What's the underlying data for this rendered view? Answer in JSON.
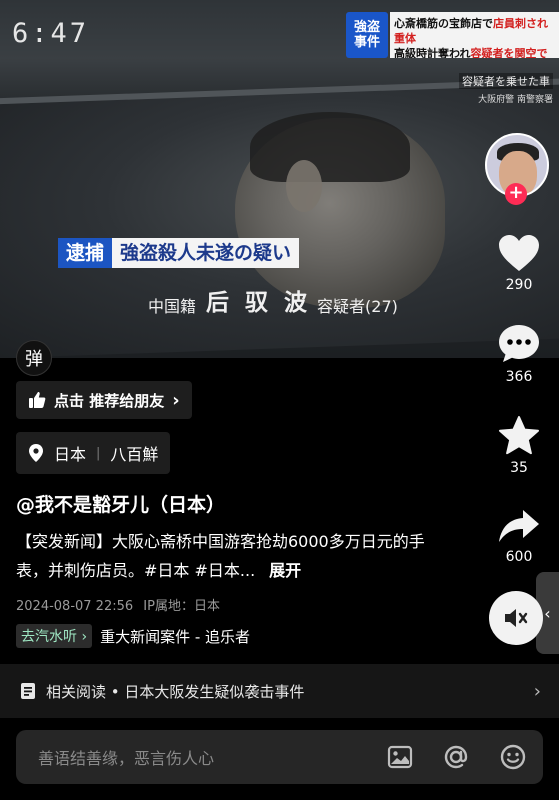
{
  "video": {
    "clock": "6:47",
    "tag": [
      "強盗",
      "事件"
    ],
    "headline": {
      "line1_a": "心斎橋筋の宝飾店で",
      "line1_b": "店員刺され重体",
      "line2_a": "高級時計奪われ",
      "line2_b": "容疑者を関空で逮捕"
    },
    "caption": "容疑者を乗せた車",
    "caption_source": "大阪府警 南警察署",
    "arrest_label": "逮捕",
    "charge": "強盗殺人未遂の疑い",
    "nationality": "中国籍",
    "suspect_name": "后 驭 波",
    "suspect_suffix": "容疑者(27)"
  },
  "danmu_button": "弹",
  "rail": {
    "follow_symbol": "+",
    "likes": "290",
    "comments": "366",
    "favorites": "35",
    "shares": "600"
  },
  "recommend": {
    "label": "点击 推荐给朋友",
    "chevron": "›"
  },
  "location": {
    "country": "日本",
    "place": "八百鮮"
  },
  "author": "@我不是豁牙儿（日本）",
  "description": "【突发新闻】大阪心斋桥中国游客抢劫6000多万日元的手表，并刺伤店员。#日本 #日本...",
  "expand_label": "展开",
  "meta": {
    "datetime": "2024-08-07 22:56",
    "ip_label": "IP属地：日本"
  },
  "music": {
    "chip": "去汽水听 ›",
    "title": "重大新闻案件 - 追乐者"
  },
  "related": {
    "text": "相关阅读 • 日本大阪发生疑似袭击事件",
    "chevron": "›"
  },
  "comment_input": {
    "placeholder": "善语结善缘，恶言伤人心"
  },
  "colors": {
    "accent": "#fe2c55",
    "news_blue": "#1c55c2",
    "news_red": "#d3201f"
  }
}
